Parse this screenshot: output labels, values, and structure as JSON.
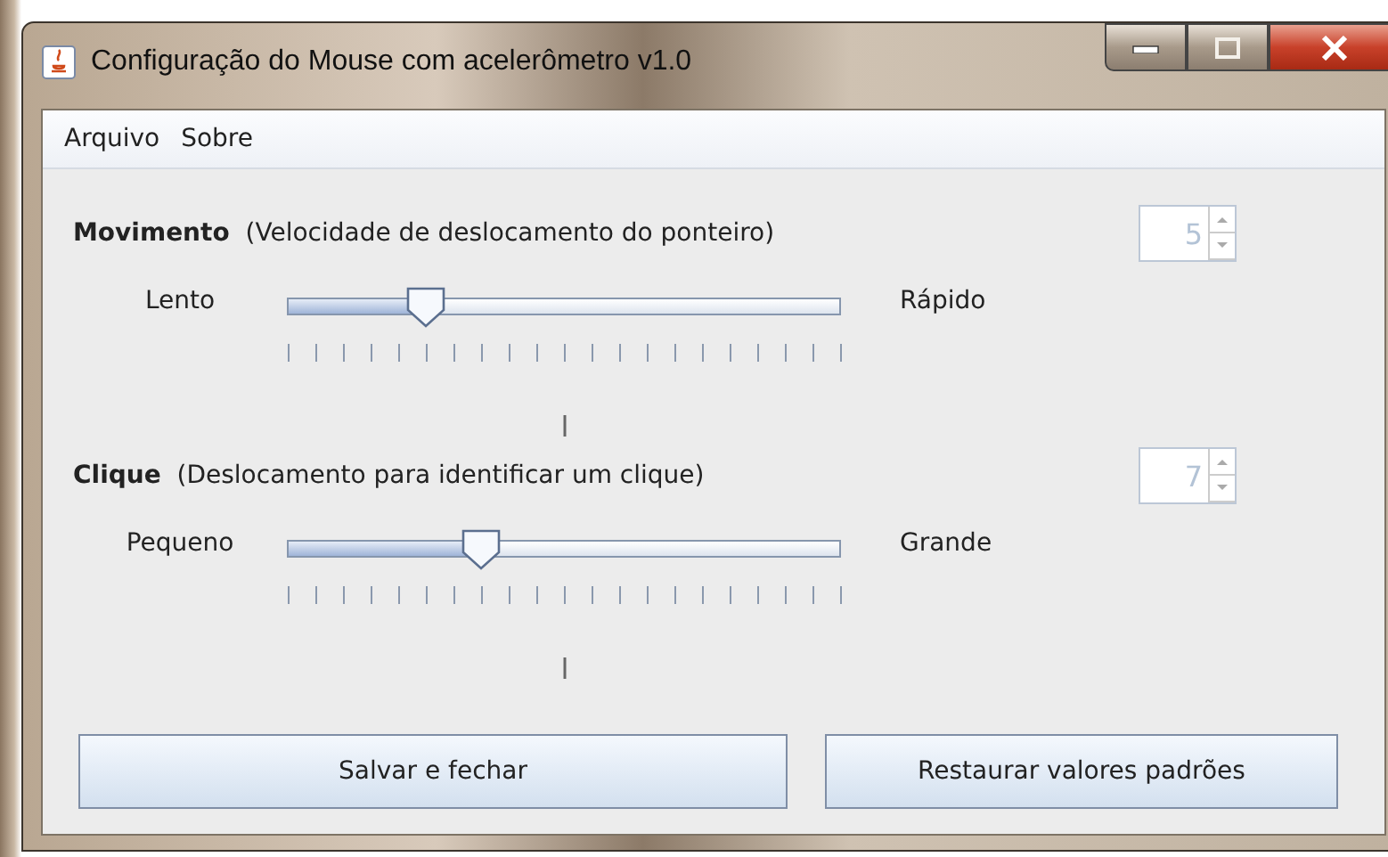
{
  "window": {
    "title": "Configuração do Mouse com acelerômetro v1.0"
  },
  "menu": [
    "Arquivo",
    "Sobre"
  ],
  "settings": [
    {
      "heading": "Movimento",
      "description": "(Velocidade de deslocamento do ponteiro)",
      "value": "5",
      "disabled": true,
      "min_label": "Lento",
      "max_label": "Rápido",
      "level": 0.25
    },
    {
      "heading": "Clique",
      "description": "(Deslocamento para identificar um clique)",
      "value": "7",
      "disabled": true,
      "min_label": "Pequeno",
      "max_label": "Grande",
      "level": 0.35
    }
  ],
  "buttons": [
    "Salvar e fechar",
    "Restaurar valores padrões"
  ]
}
